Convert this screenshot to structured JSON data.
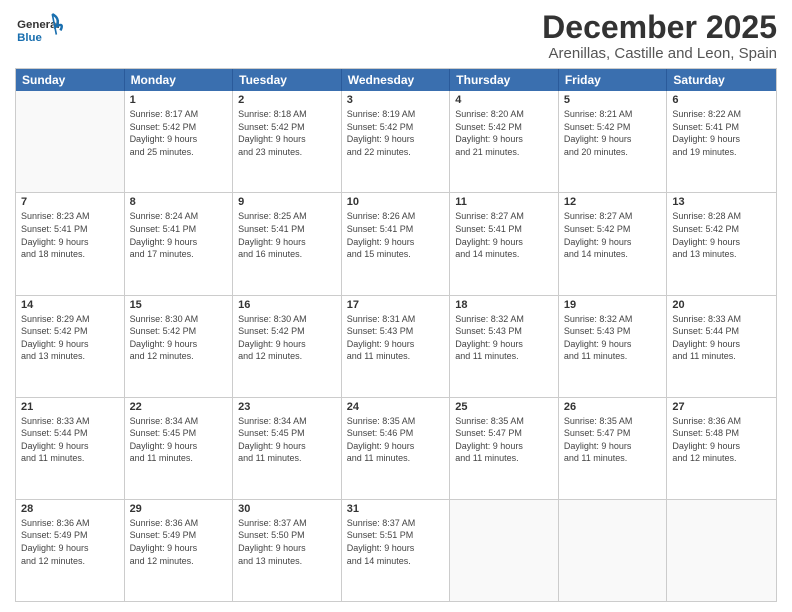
{
  "header": {
    "logo_general": "General",
    "logo_blue": "Blue",
    "month": "December 2025",
    "location": "Arenillas, Castille and Leon, Spain"
  },
  "weekdays": [
    "Sunday",
    "Monday",
    "Tuesday",
    "Wednesday",
    "Thursday",
    "Friday",
    "Saturday"
  ],
  "weeks": [
    [
      {
        "day": "",
        "info": ""
      },
      {
        "day": "1",
        "info": "Sunrise: 8:17 AM\nSunset: 5:42 PM\nDaylight: 9 hours\nand 25 minutes."
      },
      {
        "day": "2",
        "info": "Sunrise: 8:18 AM\nSunset: 5:42 PM\nDaylight: 9 hours\nand 23 minutes."
      },
      {
        "day": "3",
        "info": "Sunrise: 8:19 AM\nSunset: 5:42 PM\nDaylight: 9 hours\nand 22 minutes."
      },
      {
        "day": "4",
        "info": "Sunrise: 8:20 AM\nSunset: 5:42 PM\nDaylight: 9 hours\nand 21 minutes."
      },
      {
        "day": "5",
        "info": "Sunrise: 8:21 AM\nSunset: 5:42 PM\nDaylight: 9 hours\nand 20 minutes."
      },
      {
        "day": "6",
        "info": "Sunrise: 8:22 AM\nSunset: 5:41 PM\nDaylight: 9 hours\nand 19 minutes."
      }
    ],
    [
      {
        "day": "7",
        "info": "Sunrise: 8:23 AM\nSunset: 5:41 PM\nDaylight: 9 hours\nand 18 minutes."
      },
      {
        "day": "8",
        "info": "Sunrise: 8:24 AM\nSunset: 5:41 PM\nDaylight: 9 hours\nand 17 minutes."
      },
      {
        "day": "9",
        "info": "Sunrise: 8:25 AM\nSunset: 5:41 PM\nDaylight: 9 hours\nand 16 minutes."
      },
      {
        "day": "10",
        "info": "Sunrise: 8:26 AM\nSunset: 5:41 PM\nDaylight: 9 hours\nand 15 minutes."
      },
      {
        "day": "11",
        "info": "Sunrise: 8:27 AM\nSunset: 5:41 PM\nDaylight: 9 hours\nand 14 minutes."
      },
      {
        "day": "12",
        "info": "Sunrise: 8:27 AM\nSunset: 5:42 PM\nDaylight: 9 hours\nand 14 minutes."
      },
      {
        "day": "13",
        "info": "Sunrise: 8:28 AM\nSunset: 5:42 PM\nDaylight: 9 hours\nand 13 minutes."
      }
    ],
    [
      {
        "day": "14",
        "info": "Sunrise: 8:29 AM\nSunset: 5:42 PM\nDaylight: 9 hours\nand 13 minutes."
      },
      {
        "day": "15",
        "info": "Sunrise: 8:30 AM\nSunset: 5:42 PM\nDaylight: 9 hours\nand 12 minutes."
      },
      {
        "day": "16",
        "info": "Sunrise: 8:30 AM\nSunset: 5:42 PM\nDaylight: 9 hours\nand 12 minutes."
      },
      {
        "day": "17",
        "info": "Sunrise: 8:31 AM\nSunset: 5:43 PM\nDaylight: 9 hours\nand 11 minutes."
      },
      {
        "day": "18",
        "info": "Sunrise: 8:32 AM\nSunset: 5:43 PM\nDaylight: 9 hours\nand 11 minutes."
      },
      {
        "day": "19",
        "info": "Sunrise: 8:32 AM\nSunset: 5:43 PM\nDaylight: 9 hours\nand 11 minutes."
      },
      {
        "day": "20",
        "info": "Sunrise: 8:33 AM\nSunset: 5:44 PM\nDaylight: 9 hours\nand 11 minutes."
      }
    ],
    [
      {
        "day": "21",
        "info": "Sunrise: 8:33 AM\nSunset: 5:44 PM\nDaylight: 9 hours\nand 11 minutes."
      },
      {
        "day": "22",
        "info": "Sunrise: 8:34 AM\nSunset: 5:45 PM\nDaylight: 9 hours\nand 11 minutes."
      },
      {
        "day": "23",
        "info": "Sunrise: 8:34 AM\nSunset: 5:45 PM\nDaylight: 9 hours\nand 11 minutes."
      },
      {
        "day": "24",
        "info": "Sunrise: 8:35 AM\nSunset: 5:46 PM\nDaylight: 9 hours\nand 11 minutes."
      },
      {
        "day": "25",
        "info": "Sunrise: 8:35 AM\nSunset: 5:47 PM\nDaylight: 9 hours\nand 11 minutes."
      },
      {
        "day": "26",
        "info": "Sunrise: 8:35 AM\nSunset: 5:47 PM\nDaylight: 9 hours\nand 11 minutes."
      },
      {
        "day": "27",
        "info": "Sunrise: 8:36 AM\nSunset: 5:48 PM\nDaylight: 9 hours\nand 12 minutes."
      }
    ],
    [
      {
        "day": "28",
        "info": "Sunrise: 8:36 AM\nSunset: 5:49 PM\nDaylight: 9 hours\nand 12 minutes."
      },
      {
        "day": "29",
        "info": "Sunrise: 8:36 AM\nSunset: 5:49 PM\nDaylight: 9 hours\nand 12 minutes."
      },
      {
        "day": "30",
        "info": "Sunrise: 8:37 AM\nSunset: 5:50 PM\nDaylight: 9 hours\nand 13 minutes."
      },
      {
        "day": "31",
        "info": "Sunrise: 8:37 AM\nSunset: 5:51 PM\nDaylight: 9 hours\nand 14 minutes."
      },
      {
        "day": "",
        "info": ""
      },
      {
        "day": "",
        "info": ""
      },
      {
        "day": "",
        "info": ""
      }
    ]
  ]
}
